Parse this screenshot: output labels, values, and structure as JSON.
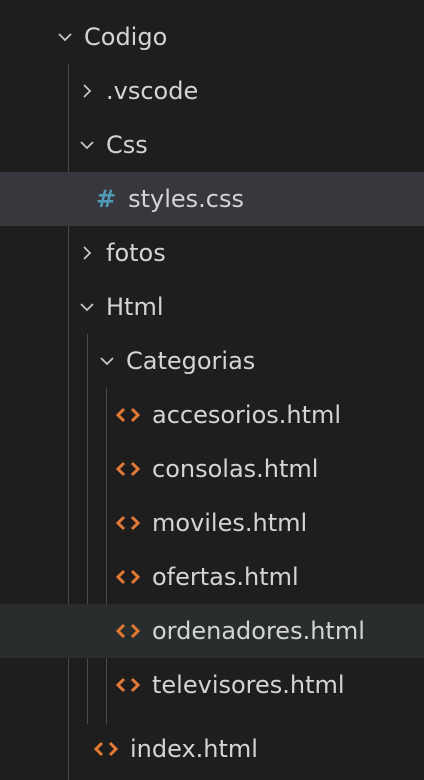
{
  "colors": {
    "background": "#1e1e1e",
    "selected_row": "#37373d",
    "hover_row": "#2a2d2e",
    "text": "#d4d4d4",
    "css_icon": "#519aba",
    "html_icon": "#e37933",
    "indent_guide": "#4a4a4a"
  },
  "tree": {
    "codigo": {
      "label": "Codigo",
      "state": "expanded",
      "icon": "chevron-down-icon"
    },
    "vscode": {
      "label": ".vscode",
      "state": "collapsed",
      "icon": "chevron-right-icon"
    },
    "css": {
      "label": "Css",
      "state": "expanded",
      "icon": "chevron-down-icon"
    },
    "styles_css": {
      "label": "styles.css",
      "icon": "hash-icon",
      "icon_glyph": "#"
    },
    "fotos": {
      "label": "fotos",
      "state": "collapsed",
      "icon": "chevron-right-icon"
    },
    "html": {
      "label": "Html",
      "state": "expanded",
      "icon": "chevron-down-icon"
    },
    "categorias": {
      "label": "Categorias",
      "state": "expanded",
      "icon": "chevron-down-icon"
    },
    "accesorios": {
      "label": "accesorios.html",
      "icon": "html-icon"
    },
    "consolas": {
      "label": "consolas.html",
      "icon": "html-icon"
    },
    "moviles": {
      "label": "moviles.html",
      "icon": "html-icon"
    },
    "ofertas": {
      "label": "ofertas.html",
      "icon": "html-icon"
    },
    "ordenadores": {
      "label": "ordenadores.html",
      "icon": "html-icon"
    },
    "televisores": {
      "label": "televisores.html",
      "icon": "html-icon"
    },
    "index": {
      "label": "index.html",
      "icon": "html-icon"
    }
  }
}
